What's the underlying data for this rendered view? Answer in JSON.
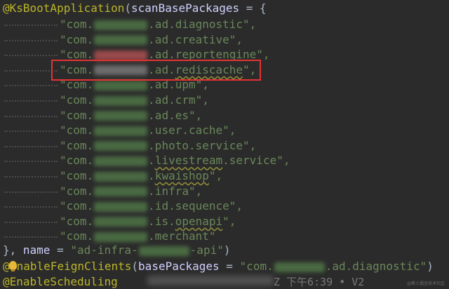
{
  "code": {
    "line1_annotation": "@KsBootApplication",
    "line1_open": "(",
    "line1_param": "scanBasePackages",
    "line1_assign": " = {",
    "packages": [
      {
        "prefix": "\"com.",
        "suffix": ".ad.diagnostic\",",
        "squiggle": ""
      },
      {
        "prefix": "\"com.",
        "suffix": ".ad.creative\",",
        "squiggle": ""
      },
      {
        "prefix": "\"com.",
        "suffix": ".ad.reportengine\",",
        "squiggle": ""
      },
      {
        "prefix": "\"com.",
        "suffix": ".ad.",
        "squiggle": "rediscache",
        "tail": "\","
      },
      {
        "prefix": "\"com.",
        "suffix": ".ad.upm\",",
        "squiggle": ""
      },
      {
        "prefix": "\"com.",
        "suffix": ".ad.crm\",",
        "squiggle": ""
      },
      {
        "prefix": "\"com.",
        "suffix": ".ad.es\",",
        "squiggle": ""
      },
      {
        "prefix": "\"com.",
        "suffix": ".user.cache\",",
        "squiggle": ""
      },
      {
        "prefix": "\"com.",
        "suffix": ".photo.service\",",
        "squiggle": ""
      },
      {
        "prefix": "\"com.",
        "suffix": ".",
        "squiggle": "livestream",
        "tail": ".service\","
      },
      {
        "prefix": "\"com.",
        "suffix": ".",
        "squiggle": "kwaishop",
        "tail": "\","
      },
      {
        "prefix": "\"com.",
        "suffix": ".infra\",",
        "squiggle": ""
      },
      {
        "prefix": "\"com.",
        "suffix": ".id.sequence\",",
        "squiggle": ""
      },
      {
        "prefix": "\"com.",
        "suffix": ".is.",
        "squiggle": "openapi",
        "tail": "\","
      },
      {
        "prefix": "\"com.",
        "suffix": ".merchant\"",
        "squiggle": ""
      }
    ],
    "close_line": {
      "brace": "}, ",
      "name_key": "name",
      "eq": " = ",
      "str_start": "\"ad-infra-",
      "str_end": "-api\"",
      "paren": ")"
    },
    "feign_line": {
      "annotation": "nableFeignClients",
      "open": "(",
      "param": "basePackages",
      "eq": " = ",
      "str_start": "\"com.",
      "str_end": ".ad.diagnostic\"",
      "close": ")"
    },
    "scheduling_line": {
      "annotation": "@EnableScheduling"
    },
    "inline_blame": "Z 下午6:39 • V2",
    "watermark": "@稀土掘金技术社区"
  },
  "colors": {
    "background": "#2b2b2b",
    "annotation": "#bbb529",
    "string": "#6a8759",
    "highlight_box": "#e53333"
  }
}
